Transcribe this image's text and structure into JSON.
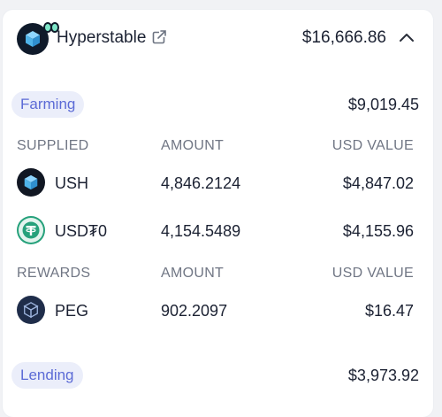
{
  "protocol": {
    "name": "Hyperstable",
    "total": "$16,666.86",
    "logo_icon": "hyperstable-cube-icon",
    "external_icon": "external-link-icon",
    "collapse_icon": "chevron-up-icon"
  },
  "farming": {
    "label": "Farming",
    "total": "$9,019.45",
    "supplied_header": {
      "col1": "SUPPLIED",
      "col2": "AMOUNT",
      "col3": "USD VALUE"
    },
    "supplied": [
      {
        "token": "USH",
        "amount": "4,846.2124",
        "usd": "$4,847.02",
        "icon": "ush-cube-icon"
      },
      {
        "token": "USD₮0",
        "amount": "4,154.5489",
        "usd": "$4,155.96",
        "icon": "usdt0-icon"
      }
    ],
    "rewards_header": {
      "col1": "REWARDS",
      "col2": "AMOUNT",
      "col3": "USD VALUE"
    },
    "rewards": [
      {
        "token": "PEG",
        "amount": "902.2097",
        "usd": "$16.47",
        "icon": "peg-cube-icon"
      }
    ]
  },
  "lending": {
    "label": "Lending",
    "total": "$3,973.92"
  },
  "colors": {
    "pill_bg": "#ebeefa",
    "pill_text": "#5c6bd6",
    "tether_green": "#26a17b",
    "cube_blue": "#4fb3e8"
  }
}
